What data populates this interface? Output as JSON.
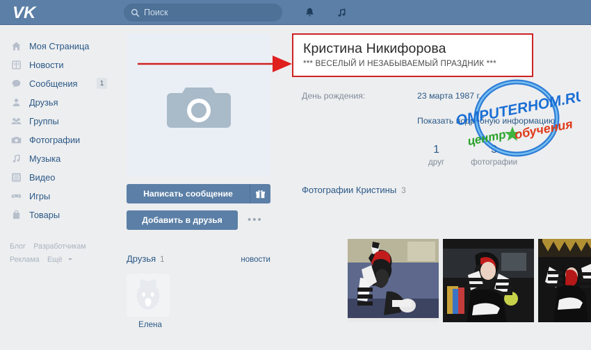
{
  "topbar": {
    "logo": "vk-logo",
    "search": {
      "placeholder": "Поиск",
      "value": ""
    },
    "icons": [
      {
        "name": "bell-icon",
        "label": "Уведомления"
      },
      {
        "name": "music-icon",
        "label": "Музыка"
      }
    ]
  },
  "sidebar": {
    "items": [
      {
        "icon": "home-icon",
        "label": "Моя Страница",
        "badge": ""
      },
      {
        "icon": "news-icon",
        "label": "Новости",
        "badge": ""
      },
      {
        "icon": "message-icon",
        "label": "Сообщения",
        "badge": "1"
      },
      {
        "icon": "friends-icon",
        "label": "Друзья",
        "badge": ""
      },
      {
        "icon": "groups-icon",
        "label": "Группы",
        "badge": ""
      },
      {
        "icon": "camera-icon",
        "label": "Фотографии",
        "badge": ""
      },
      {
        "icon": "music-icon",
        "label": "Музыка",
        "badge": ""
      },
      {
        "icon": "video-icon",
        "label": "Видео",
        "badge": ""
      },
      {
        "icon": "games-icon",
        "label": "Игры",
        "badge": ""
      },
      {
        "icon": "goods-icon",
        "label": "Товары",
        "badge": ""
      }
    ],
    "footer": {
      "blog": "Блог",
      "developers": "Разработчикам",
      "ads": "Реклама",
      "more": "Ещё"
    }
  },
  "profile": {
    "avatar_placeholder_icon": "camera-placeholder-icon",
    "message_button": "Написать сообщение",
    "gift_icon": "gift-icon",
    "add_friend_button": "Добавить в друзья",
    "more_actions": "•••",
    "name": "Кристина Никифорова",
    "status": "*** ВЕСЕЛЫЙ И НЕЗАБЫВАЕМЫЙ ПРАЗДНИК ***",
    "info": {
      "birthday_label": "День рождения:",
      "birthday_value": "23 марта 1987 г.",
      "show_details": "Показать подробную информацию"
    },
    "counters": [
      {
        "num": "1",
        "cap": "друг"
      },
      {
        "num": "3",
        "cap": "фотографии"
      }
    ]
  },
  "friends_block": {
    "title": "Друзья",
    "count": "1",
    "news_link": "новости",
    "friends": [
      {
        "name": "Елена",
        "avatar_icon": "dog-avatar-icon"
      }
    ]
  },
  "photos_block": {
    "title": "Фотографии Кристины",
    "count": "3",
    "photos": [
      {
        "alt": "Женщина в пиратском костюме у синей стены"
      },
      {
        "alt": "Женщина в пиратском костюме в тёмном зале"
      },
      {
        "alt": "Женщина в пиратском костюме с красным шаром и ребёнок"
      }
    ]
  },
  "annotation": {
    "arrow": "red-arrow-pointing-to-name",
    "highlight_color": "#cc2222"
  },
  "watermark": {
    "domain": "COMPUTERHOM.RU",
    "center_word": "центр",
    "learning_word": "обучения",
    "colors": {
      "domain": "#1a6fd4",
      "center": "#2aa32a",
      "learning": "#e03a1a"
    }
  }
}
